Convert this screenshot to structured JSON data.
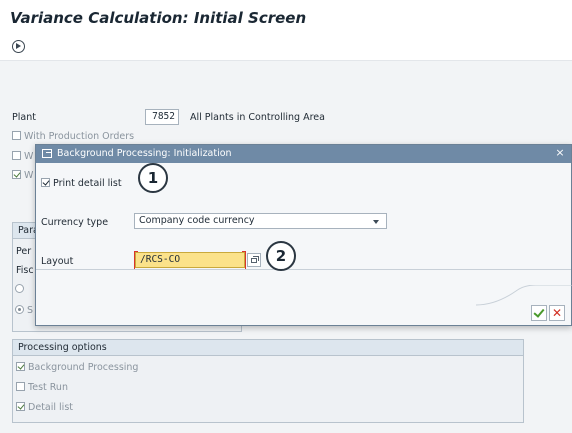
{
  "window": {
    "title": "Variance Calculation: Initial Screen"
  },
  "toolbar": {
    "execute_icon": "execute-clock-icon"
  },
  "selection": {
    "plant_label": "Plant",
    "plant_value": "7852",
    "plant_all_label": "All Plants in Controlling Area",
    "with_production_orders": "With Production Orders",
    "row_w1": "W",
    "row_w2": "W"
  },
  "parameters": {
    "group_label_partial": "Para",
    "period_partial": "Per",
    "fiscal_partial": "Fisc",
    "radio1_partial": "",
    "radio2_partial": "S"
  },
  "processing": {
    "group_label": "Processing options",
    "background_processing": "Background Processing",
    "test_run": "Test Run",
    "detail_list": "Detail list"
  },
  "dialog": {
    "title": "Background Processing: Initialization",
    "print_detail_list": "Print detail list",
    "currency_type_label": "Currency type",
    "currency_type_value": "Company code currency",
    "layout_label": "Layout",
    "layout_value": "/RCS-CO",
    "close": "×",
    "cancel": "✕"
  },
  "callouts": {
    "one": "1",
    "two": "2"
  },
  "colors": {
    "dialog_header": "#6f8aa6",
    "layout_highlight": "#fbe28a",
    "required_bracket": "#d9342b",
    "ok_green": "#4a9a2b",
    "cancel_red": "#d22f22"
  }
}
